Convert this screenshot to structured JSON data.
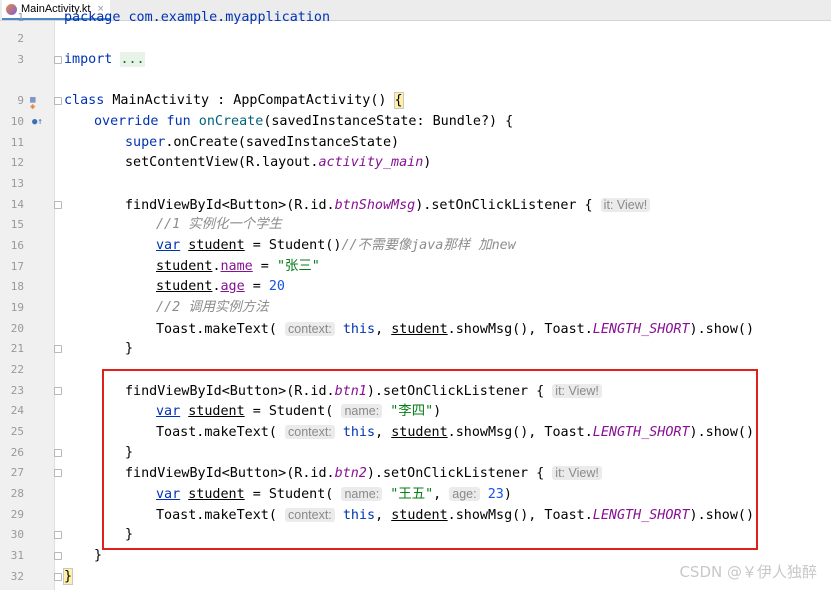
{
  "tab": {
    "filename": "MainActivity.kt",
    "close": "×"
  },
  "watermark": "CSDN @￥伊人独醉",
  "lines": [
    {
      "n": "1"
    },
    {
      "n": "2"
    },
    {
      "n": "3"
    },
    {
      "n": "9"
    },
    {
      "n": "10"
    },
    {
      "n": "11"
    },
    {
      "n": "12"
    },
    {
      "n": "13"
    },
    {
      "n": "14"
    },
    {
      "n": "15"
    },
    {
      "n": "16"
    },
    {
      "n": "17"
    },
    {
      "n": "18"
    },
    {
      "n": "19"
    },
    {
      "n": "20"
    },
    {
      "n": "21"
    },
    {
      "n": "22"
    },
    {
      "n": "23"
    },
    {
      "n": "24"
    },
    {
      "n": "25"
    },
    {
      "n": "26"
    },
    {
      "n": "27"
    },
    {
      "n": "28"
    },
    {
      "n": "29"
    },
    {
      "n": "30"
    },
    {
      "n": "31"
    },
    {
      "n": "32"
    }
  ],
  "code": {
    "l1": "package com.example.myapplication",
    "l3_import": "import",
    "l3_dots": "...",
    "l9_class": "class",
    "l9_name": " MainActivity : AppCompatActivity() ",
    "l9_brace": "{",
    "l10_override": "override fun",
    "l10_fn": " onCreate",
    "l10_rest": "(savedInstanceState: Bundle?) {",
    "l11_super": "super",
    "l11_rest": ".onCreate(savedInstanceState)",
    "l12_a": "setContentView(R.layout.",
    "l12_b": "activity_main",
    "l12_c": ")",
    "l14_a": "findViewById<Button>(R.id.",
    "l14_b": "btnShowMsg",
    "l14_c": ").setOnClickListener { ",
    "hint_it": "it: View!",
    "l15": "//1 实例化一个学生",
    "var": "var",
    "student": "student",
    "l16_rest": " = Student()",
    "l16_cm": "//不需要像java那样 加new",
    "l17_prop": "name",
    "l17_eq": " = ",
    "l17_str": "\"张三\"",
    "l18_prop": "age",
    "l18_num": "20",
    "l19": "//2 调用实例方法",
    "toast_a": "Toast.makeText( ",
    "hint_context": "context:",
    "this": "this",
    "toast_b": ".showMsg(), Toast.",
    "length_short": "LENGTH_SHORT",
    "toast_c": ").show()",
    "close_brace": "}",
    "l23_b": "btn1",
    "l24_rest": " = Student( ",
    "hint_name": "name:",
    "l24_str": "\"李四\"",
    "l24_end": ")",
    "l27_b": "btn2",
    "l28_str": "\"王五\"",
    "hint_age": "age:",
    "l28_num": "23"
  }
}
